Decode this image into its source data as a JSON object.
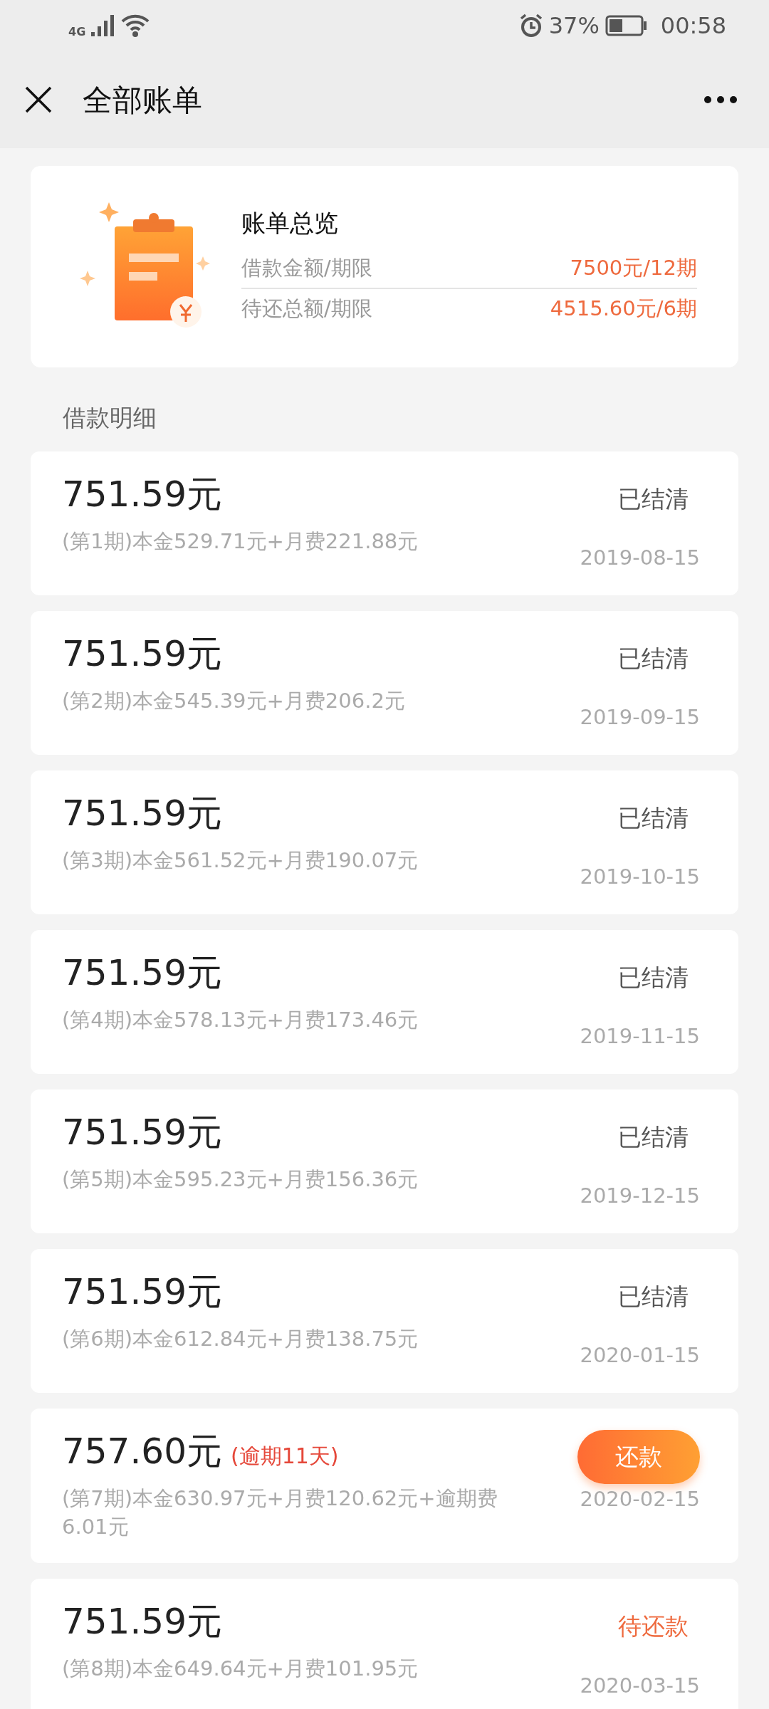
{
  "status_bar": {
    "network": "4G",
    "battery_percent": "37%",
    "time": "00:58"
  },
  "header": {
    "title": "全部账单"
  },
  "summary": {
    "title": "账单总览",
    "rows": [
      {
        "label": "借款金额/期限",
        "value": "7500元/12期"
      },
      {
        "label": "待还总额/期限",
        "value": "4515.60元/6期"
      }
    ]
  },
  "section_title": "借款明细",
  "bills": [
    {
      "kind": "settled",
      "amount": "751.59元",
      "status": "已结清",
      "detail": "(第1期)本金529.71元+月费221.88元",
      "date": "2019-08-15"
    },
    {
      "kind": "settled",
      "amount": "751.59元",
      "status": "已结清",
      "detail": "(第2期)本金545.39元+月费206.2元",
      "date": "2019-09-15"
    },
    {
      "kind": "settled",
      "amount": "751.59元",
      "status": "已结清",
      "detail": "(第3期)本金561.52元+月费190.07元",
      "date": "2019-10-15"
    },
    {
      "kind": "settled",
      "amount": "751.59元",
      "status": "已结清",
      "detail": "(第4期)本金578.13元+月费173.46元",
      "date": "2019-11-15"
    },
    {
      "kind": "settled",
      "amount": "751.59元",
      "status": "已结清",
      "detail": "(第5期)本金595.23元+月费156.36元",
      "date": "2019-12-15"
    },
    {
      "kind": "settled",
      "amount": "751.59元",
      "status": "已结清",
      "detail": "(第6期)本金612.84元+月费138.75元",
      "date": "2020-01-15"
    },
    {
      "kind": "overdue",
      "amount": "757.60元",
      "note": "(逾期11天)",
      "status": "还款",
      "detail": "(第7期)本金630.97元+月费120.62元+逾期费6.01元",
      "date": "2020-02-15"
    },
    {
      "kind": "pending",
      "amount": "751.59元",
      "status": "待还款",
      "detail": "(第8期)本金649.64元+月费101.95元",
      "date": "2020-03-15"
    }
  ]
}
